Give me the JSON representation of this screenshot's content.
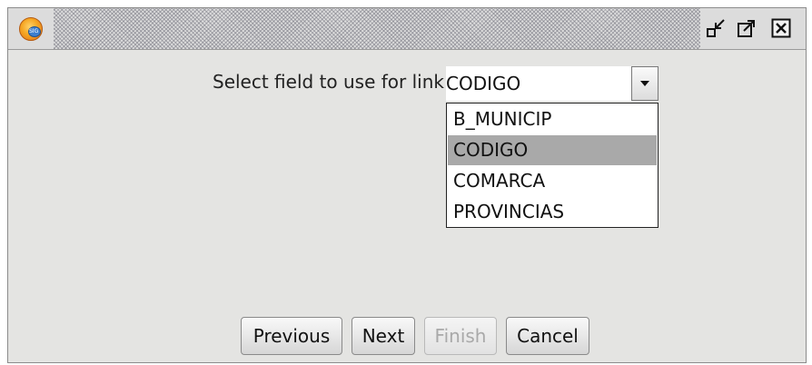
{
  "window": {
    "title": "",
    "controls": [
      "minimize-icon",
      "maximize-icon",
      "close-icon"
    ]
  },
  "app_icon": {
    "name": "app-logo-icon",
    "text": "SIG",
    "colors": {
      "outer": "#f5a623",
      "globe": "#3d7fcf"
    }
  },
  "link_field": {
    "label": "Select field to use for link",
    "selected_value": "CODIGO",
    "options": [
      "B_MUNICIP",
      "CODIGO",
      "COMARCA",
      "PROVINCIAS"
    ],
    "selected_index": 1,
    "dropdown_open": true
  },
  "buttons": {
    "previous": "Previous",
    "next": "Next",
    "finish": "Finish",
    "cancel": "Cancel",
    "finish_enabled": false
  },
  "colors": {
    "window_bg": "#e4e4e2",
    "selection_bg": "#a9a9a9",
    "disabled_text": "#a9a9a9"
  }
}
